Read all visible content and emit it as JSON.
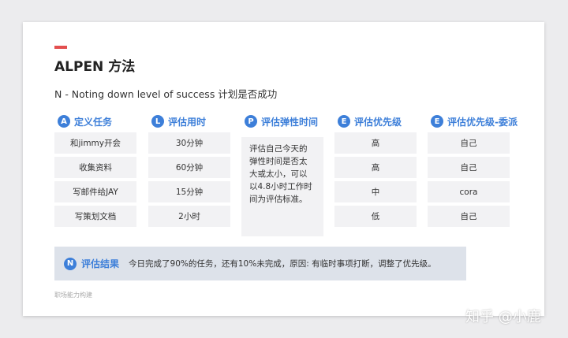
{
  "slide": {
    "title": "ALPEN 方法",
    "subtitle": "N - Noting down level of success 计划是否成功",
    "footer": "职场能力构建"
  },
  "columns": [
    {
      "letter": "A",
      "title": "定义任务",
      "cells": [
        "和jimmy开会",
        "收集资料",
        "写邮件给JAY",
        "写策划文档"
      ]
    },
    {
      "letter": "L",
      "title": "评估用时",
      "cells": [
        "30分钟",
        "60分钟",
        "15分钟",
        "2小时"
      ]
    },
    {
      "letter": "P",
      "title": "评估弹性时间",
      "text_lines": [
        "评估自己今天的",
        "弹性时间是否太",
        "大或太小，可以",
        "以4.8小时工作时",
        "间为评估标准。"
      ]
    },
    {
      "letter": "E",
      "title": "评估优先级",
      "cells": [
        "高",
        "高",
        "中",
        "低"
      ]
    },
    {
      "letter": "E",
      "title": "评估优先级-委派",
      "cells": [
        "自己",
        "自己",
        "cora",
        "自己"
      ]
    }
  ],
  "result": {
    "letter": "N",
    "title": "评估结果",
    "text": "今日完成了90%的任务，还有10%未完成，原因: 有临时事项打断，调整了优先级。"
  },
  "watermark": "知乎 @小鹿",
  "colors": {
    "accent_red": "#e34f4f",
    "accent_blue": "#3d7fd9",
    "cell_bg": "#f2f2f4",
    "result_bg": "#dde2ea"
  }
}
